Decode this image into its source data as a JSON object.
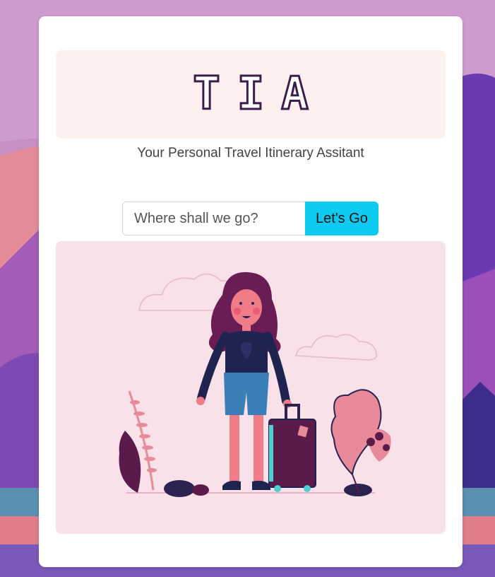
{
  "app": {
    "logo_text": "TIA",
    "tagline": "Your Personal Travel Itinerary Assitant"
  },
  "search": {
    "placeholder": "Where shall we go?",
    "value": "",
    "button_label": "Let's Go"
  },
  "colors": {
    "card": "#ffffff",
    "logo_bg": "#fff0f0",
    "logo_outline": "#3a1d4d",
    "button": "#0fcaf0",
    "illustration_bg": "#f8e1e8"
  },
  "icons": [
    "traveler-illustration"
  ]
}
